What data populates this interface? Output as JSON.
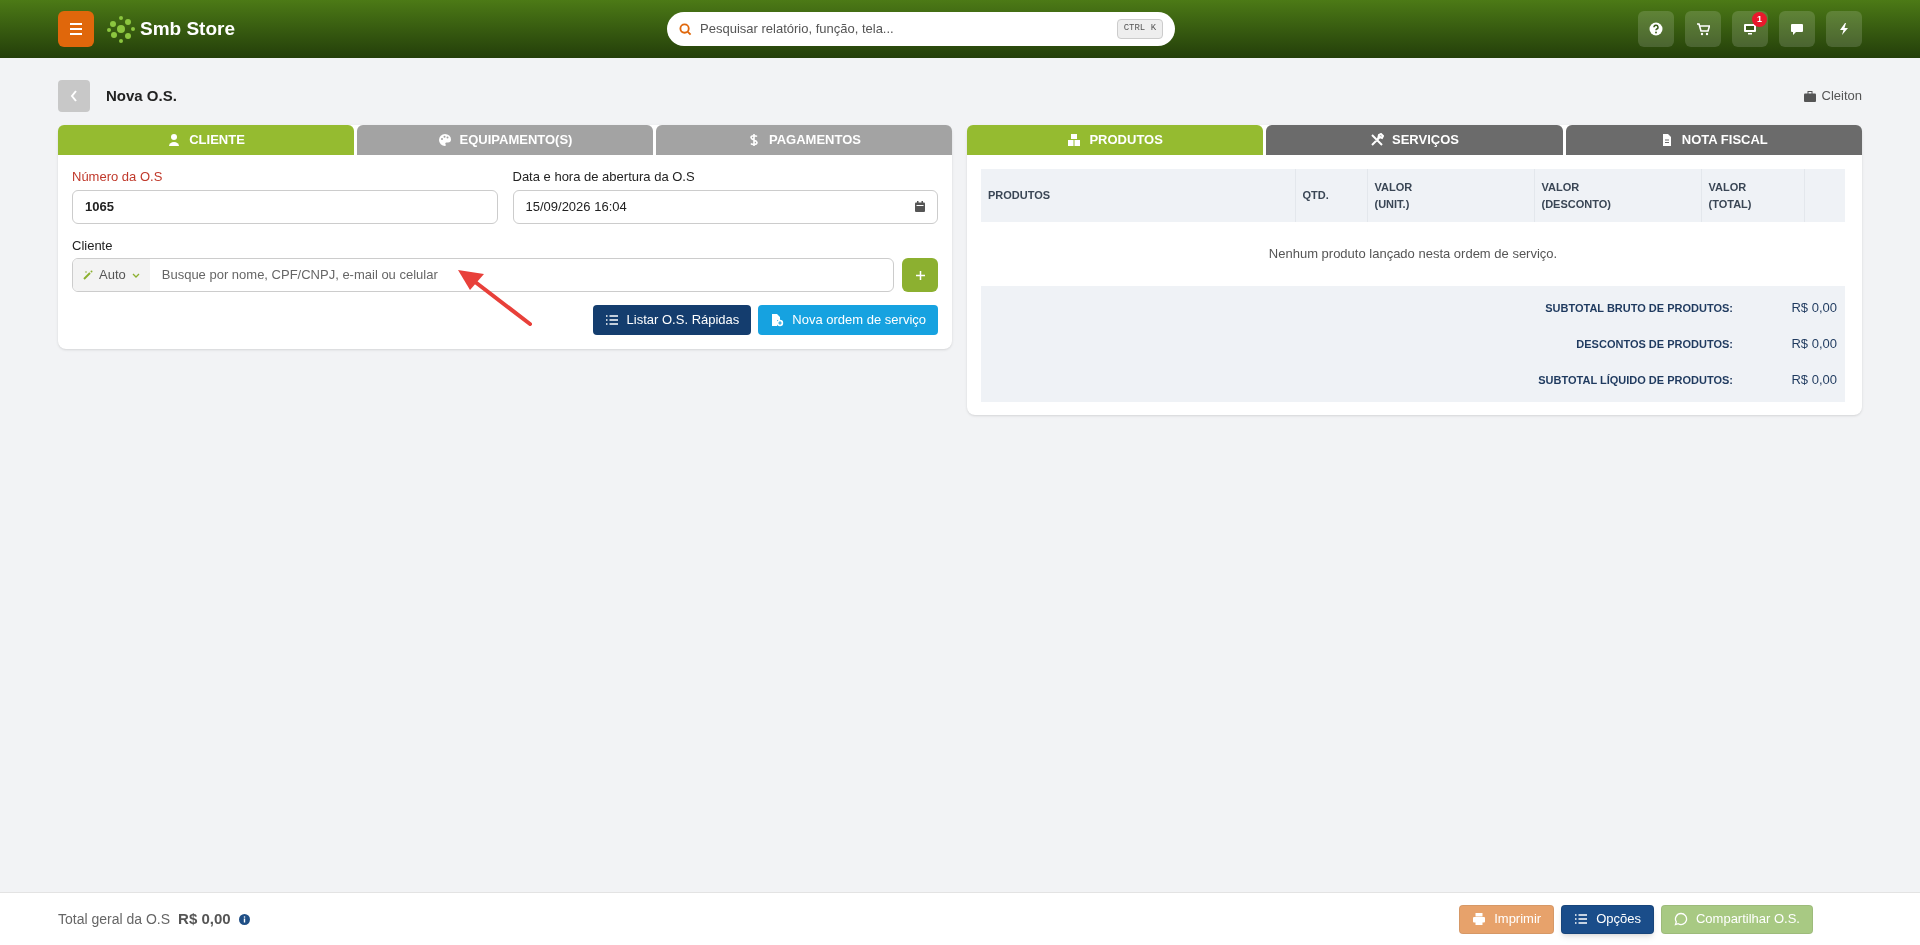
{
  "header": {
    "brand": "Smb Store",
    "search": {
      "placeholder": "Pesquisar relatório, função, tela...",
      "shortcut": "CTRL K"
    },
    "actions": [
      {
        "kind": "help"
      },
      {
        "kind": "cart"
      },
      {
        "kind": "monitor",
        "badge": "1"
      },
      {
        "kind": "chat"
      },
      {
        "kind": "bolt"
      }
    ]
  },
  "page": {
    "title": "Nova O.S.",
    "user": "Cleiton"
  },
  "left_panel": {
    "tabs": [
      {
        "label": "CLIENTE",
        "kind": "user",
        "selected": true
      },
      {
        "label": "EQUIPAMENTO(S)",
        "kind": "palette",
        "selected": false
      },
      {
        "label": "PAGAMENTOS",
        "kind": "dollar",
        "selected": false
      }
    ],
    "os_number": {
      "label": "Número da O.S",
      "value": "1065",
      "required": true
    },
    "opened_at": {
      "label": "Data e hora de abertura da O.S",
      "value": "15/09/2026 16:04",
      "required": false
    },
    "client": {
      "label": "Cliente",
      "mode": "Auto",
      "placeholder": "Busque por nome, CPF/CNPJ, e-mail ou celular"
    },
    "buttons": [
      {
        "label": "Listar O.S. Rápidas",
        "kind": "list"
      },
      {
        "label": "Nova ordem de serviço",
        "kind": "new"
      }
    ]
  },
  "right_panel": {
    "tabs": [
      {
        "label": "PRODUTOS",
        "kind": "boxes",
        "selected": true
      },
      {
        "label": "SERVIÇOS",
        "kind": "tools",
        "selected": false
      },
      {
        "label": "NOTA FISCAL",
        "kind": "file",
        "selected": false
      }
    ],
    "table": {
      "columns": [
        "PRODUTOS",
        "QTD.",
        "VALOR\n(UNIT.)",
        "VALOR\n(DESCONTO)",
        "VALOR\n(TOTAL)"
      ],
      "empty_message": "Nenhum produto lançado nesta ordem de serviço.",
      "totals": [
        {
          "label": "SUBTOTAL BRUTO DE PRODUTOS:",
          "value": "R$ 0,00"
        },
        {
          "label": "DESCONTOS DE PRODUTOS:",
          "value": "R$ 0,00"
        },
        {
          "label": "SUBTOTAL LÍQUIDO DE PRODUTOS:",
          "value": "R$ 0,00"
        }
      ]
    }
  },
  "footer": {
    "total_label": "Total geral da O.S",
    "total_value": "R$ 0,00",
    "buttons": [
      {
        "label": "Imprimir",
        "kind": "print",
        "disabled": true
      },
      {
        "label": "Opções",
        "kind": "options",
        "disabled": false
      },
      {
        "label": "Compartilhar O.S.",
        "kind": "share",
        "disabled": true
      }
    ]
  }
}
